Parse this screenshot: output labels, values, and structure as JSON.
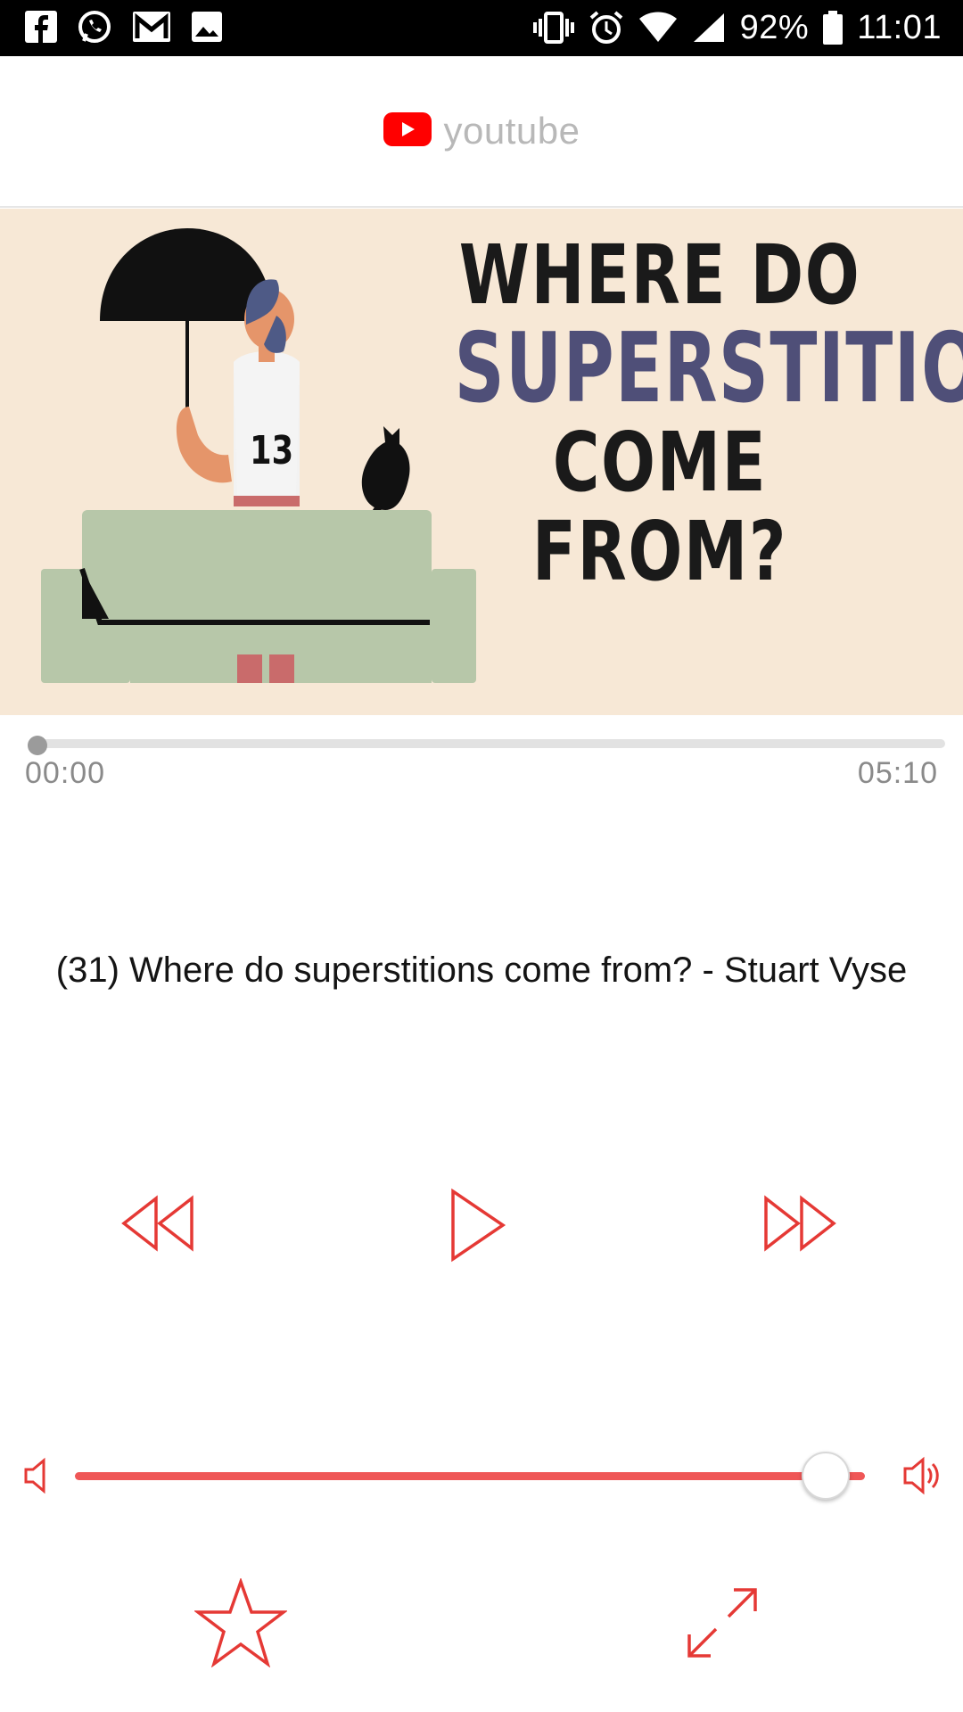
{
  "status_bar": {
    "battery_percent": "92%",
    "time": "11:01",
    "icons_left": [
      "facebook-icon",
      "whatsapp-icon",
      "gmail-icon",
      "gallery-icon"
    ],
    "icons_right": [
      "vibrate-icon",
      "alarm-icon",
      "wifi-icon",
      "signal-icon",
      "battery-icon"
    ]
  },
  "header": {
    "brand_text": "youtube",
    "brand_color": "#ff0000"
  },
  "thumbnail": {
    "line1": "WHERE DO",
    "line2": "SUPERSTITIONS",
    "line3": "COME FROM?",
    "shirt_number": "13"
  },
  "player": {
    "current_time": "00:00",
    "duration": "05:10",
    "progress_fraction": 0.0,
    "title": "(31) Where do superstitions come from? - Stuart Vyse",
    "volume_fraction": 0.95,
    "accent_color": "#e53935"
  }
}
